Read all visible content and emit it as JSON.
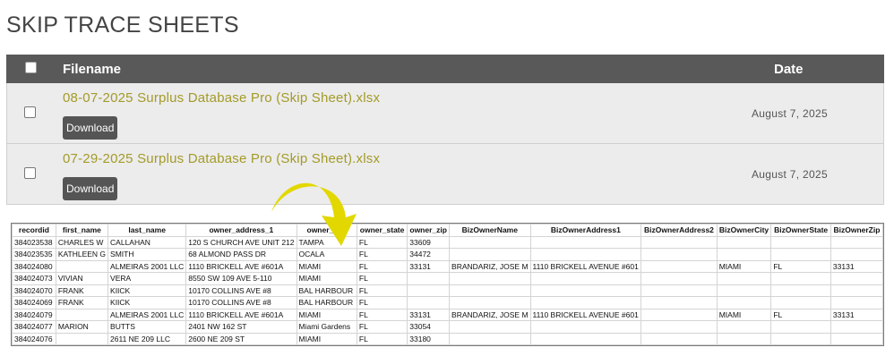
{
  "page": {
    "title": "SKIP TRACE SHEETS"
  },
  "files_table": {
    "header": {
      "filename": "Filename",
      "date": "Date"
    },
    "rows": [
      {
        "filename": "08-07-2025 Surplus Database Pro (Skip Sheet).xlsx",
        "button": "Download",
        "date": "August 7, 2025"
      },
      {
        "filename": "07-29-2025 Surplus Database Pro (Skip Sheet).xlsx",
        "button": "Download",
        "date": "August 7, 2025"
      }
    ]
  },
  "sheet": {
    "columns": [
      "recordid",
      "first_name",
      "last_name",
      "owner_address_1",
      "owner_city",
      "owner_state",
      "owner_zip",
      "BizOwnerName",
      "BizOwnerAddress1",
      "BizOwnerAddress2",
      "BizOwnerCity",
      "BizOwnerState",
      "BizOwnerZip"
    ],
    "selected_column": "BizOwnerState",
    "rows": [
      [
        "384023538",
        "CHARLES W",
        "CALLAHAN",
        "120 S CHURCH AVE UNIT 212",
        "TAMPA",
        "FL",
        "33609",
        "",
        "",
        "",
        "",
        "",
        ""
      ],
      [
        "384023535",
        "KATHLEEN G",
        "SMITH",
        "68 ALMOND PASS DR",
        "OCALA",
        "FL",
        "34472",
        "",
        "",
        "",
        "",
        "",
        ""
      ],
      [
        "384024080",
        "",
        "ALMEIRAS 2001 LLC",
        "1110 BRICKELL AVE #601A",
        "MIAMI",
        "FL",
        "33131",
        "BRANDARIZ, JOSE M",
        "1110 BRICKELL AVENUE #601",
        "",
        "MIAMI",
        "FL",
        "33131"
      ],
      [
        "384024073",
        "VIVIAN",
        "VERA",
        "8550 SW 109 AVE 5-110",
        "MIAMI",
        "FL",
        "",
        "",
        "",
        "",
        "",
        "",
        ""
      ],
      [
        "384024070",
        "FRANK",
        "KIICK",
        "10170 COLLINS AVE #8",
        "BAL HARBOUR",
        "FL",
        "",
        "",
        "",
        "",
        "",
        "",
        ""
      ],
      [
        "384024069",
        "FRANK",
        "KIICK",
        "10170 COLLINS AVE #8",
        "BAL HARBOUR",
        "FL",
        "",
        "",
        "",
        "",
        "",
        "",
        ""
      ],
      [
        "384024079",
        "",
        "ALMEIRAS 2001 LLC",
        "1110 BRICKELL AVE #601A",
        "MIAMI",
        "FL",
        "33131",
        "BRANDARIZ, JOSE M",
        "1110 BRICKELL AVENUE #601",
        "",
        "MIAMI",
        "FL",
        "33131"
      ],
      [
        "384024077",
        "MARION",
        "BUTTS",
        "2401 NW 162 ST",
        "Miami Gardens",
        "FL",
        "33054",
        "",
        "",
        "",
        "",
        "",
        ""
      ],
      [
        "384024076",
        "",
        "2611 NE 209 LLC",
        "2600 NE 209 ST",
        "MIAMI",
        "FL",
        "33180",
        "",
        "",
        "",
        "",
        "",
        ""
      ]
    ]
  },
  "colors": {
    "header_bg": "#595959",
    "row_bg": "#ececec",
    "link": "#a39b28",
    "button_bg": "#555555",
    "arrow": "#e2d800"
  },
  "icons": {
    "annotation": "curved-arrow-icon"
  }
}
